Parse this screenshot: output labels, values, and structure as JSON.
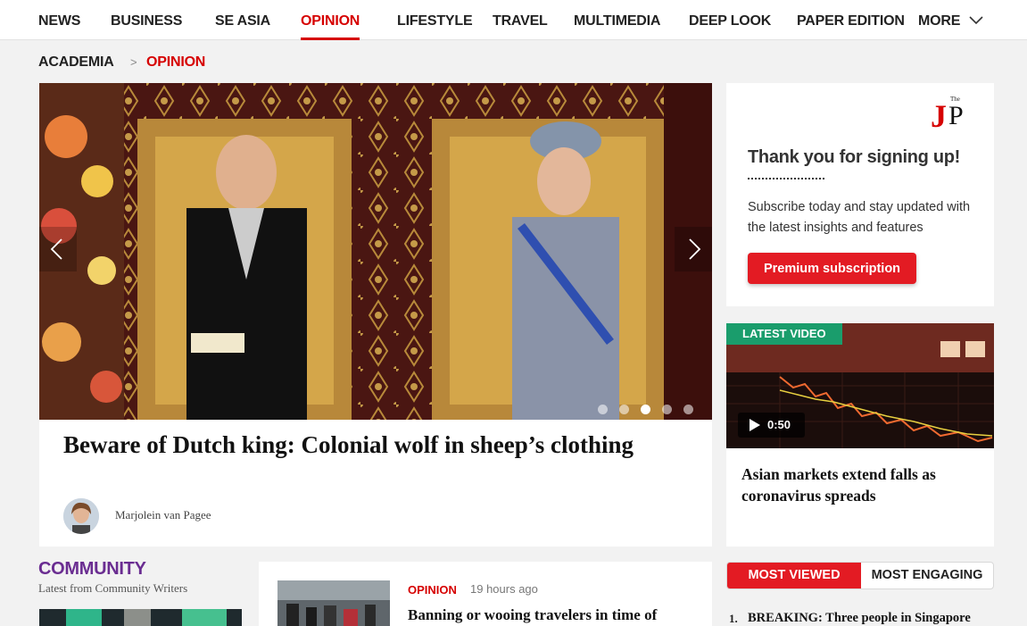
{
  "nav": {
    "items": [
      "NEWS",
      "BUSINESS",
      "SE ASIA",
      "OPINION",
      "LIFESTYLE",
      "TRAVEL",
      "MULTIMEDIA",
      "DEEP LOOK",
      "PAPER EDITION",
      "MORE"
    ],
    "active": "OPINION",
    "more_icon": "chevron-down-icon"
  },
  "breadcrumb": {
    "parent": "ACADEMIA",
    "separator": ">",
    "current": "OPINION"
  },
  "hero": {
    "title": "Beware of Dutch king: Colonial wolf in sheep’s clothing",
    "author": "Marjolein van Pagee",
    "slide_count": 5,
    "active_slide": 3,
    "prev_icon": "chevron-left-icon",
    "next_icon": "chevron-right-icon"
  },
  "signup": {
    "logo_small": "The",
    "logo_text": "JP",
    "title": "Thank you for signing up!",
    "text": "Subscribe today and stay updated with the latest insights and features",
    "button": "Premium subscription"
  },
  "video": {
    "badge": "LATEST VIDEO",
    "duration": "0:50",
    "play_icon": "play-icon",
    "title": "Asian markets extend falls as coronavirus spreads"
  },
  "community": {
    "title": "COMMUNITY",
    "subtitle": "Latest from Community Writers"
  },
  "article": {
    "category": "OPINION",
    "time": "19 hours ago",
    "title": "Banning or wooing travelers in time of"
  },
  "most": {
    "tabs": [
      "MOST VIEWED",
      "MOST ENGAGING"
    ],
    "items": [
      {
        "rank": "1.",
        "title": "BREAKING: Three people in Singapore"
      }
    ]
  },
  "colors": {
    "accent": "#e31b23",
    "nav_active": "#d60000",
    "community": "#6a2d91",
    "video_badge": "#1a9d6c"
  }
}
